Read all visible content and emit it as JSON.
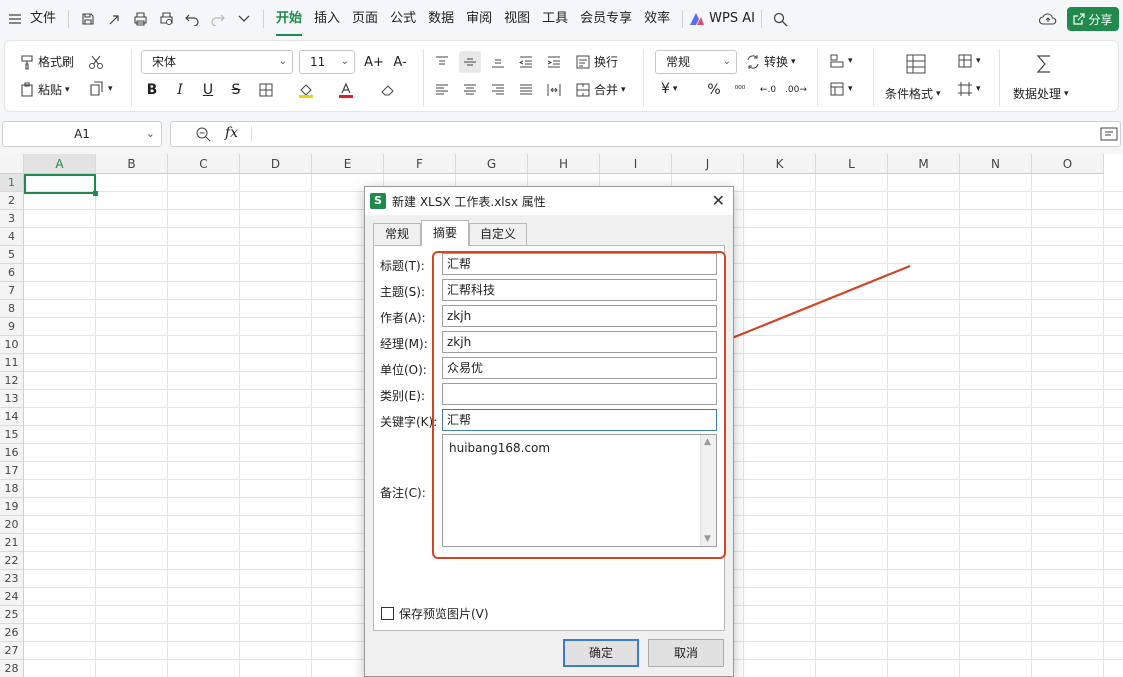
{
  "menubar": {
    "file": "文件",
    "tabs": [
      "开始",
      "插入",
      "页面",
      "公式",
      "数据",
      "审阅",
      "视图",
      "工具",
      "会员专享",
      "效率"
    ],
    "active_tab": "开始",
    "wps_ai": "WPS AI",
    "share": "分享"
  },
  "ribbon": {
    "format_painter": "格式刷",
    "paste": "粘贴",
    "font_name": "宋体",
    "font_size": "11",
    "wrap": "换行",
    "merge": "合并",
    "number_format": "常规",
    "convert": "转换",
    "cond_format": "条件格式",
    "data_process": "数据处理",
    "increase_font": "A+",
    "decrease_font": "A-",
    "bold": "B",
    "italic": "I",
    "underline": "U",
    "strike": "S",
    "currency": "¥",
    "percent": "%"
  },
  "formula_bar": {
    "cell_ref": "A1",
    "fx": "fx",
    "value": ""
  },
  "grid": {
    "columns": [
      "A",
      "B",
      "C",
      "D",
      "E",
      "F",
      "G",
      "H",
      "I",
      "J",
      "K",
      "L",
      "M",
      "N",
      "O"
    ],
    "rows": [
      "1",
      "2",
      "3",
      "4",
      "5",
      "6",
      "7",
      "8",
      "9",
      "10",
      "11",
      "12",
      "13",
      "14",
      "15",
      "16",
      "17",
      "18",
      "19",
      "20",
      "21",
      "22",
      "23",
      "24",
      "25",
      "26",
      "27",
      "28"
    ]
  },
  "dialog": {
    "title": "新建 XLSX 工作表.xlsx 属性",
    "tabs": [
      "常规",
      "摘要",
      "自定义"
    ],
    "selected_tab": "摘要",
    "fields": [
      {
        "label": "标题(T):",
        "value": "汇帮"
      },
      {
        "label": "主题(S):",
        "value": "汇帮科技"
      },
      {
        "label": "作者(A):",
        "value": "zkjh"
      },
      {
        "label": "经理(M):",
        "value": "zkjh"
      },
      {
        "label": "单位(O):",
        "value": "众易优"
      },
      {
        "label": "类别(E):",
        "value": ""
      },
      {
        "label": "关键字(K):",
        "value": "汇帮"
      }
    ],
    "notes_label": "备注(C):",
    "notes_value": "huibang168.com",
    "save_preview": "保存预览图片(V)",
    "ok": "确定",
    "cancel": "取消"
  },
  "colors": {
    "accent": "#1f8a4c",
    "highlight_box": "#d14424",
    "arrow": "#d14424"
  }
}
